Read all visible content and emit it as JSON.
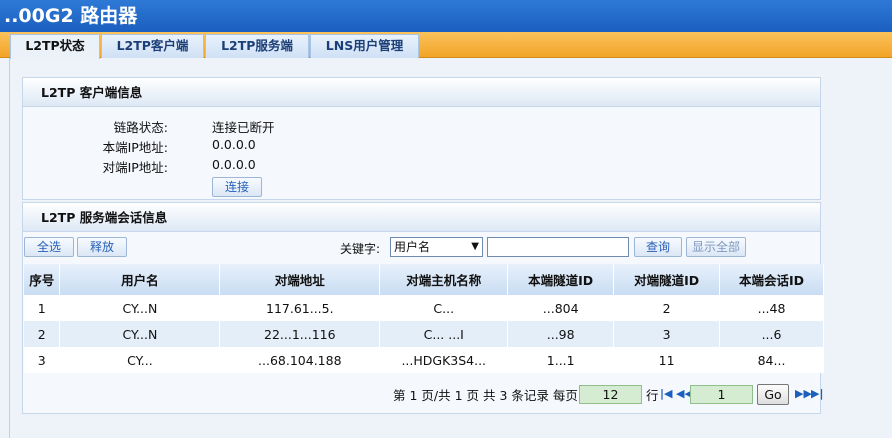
{
  "window": {
    "title": "..00G2 路由器"
  },
  "tabs": [
    {
      "label": "L2TP状态",
      "active": true
    },
    {
      "label": "L2TP客户端",
      "active": false
    },
    {
      "label": "L2TP服务端",
      "active": false
    },
    {
      "label": "LNS用户管理",
      "active": false
    }
  ],
  "client_panel": {
    "title": "L2TP 客户端信息",
    "fields": [
      {
        "label": "链路状态:",
        "value": "连接已断开"
      },
      {
        "label": "本端IP地址:",
        "value": "0.0.0.0"
      },
      {
        "label": "对端IP地址:",
        "value": "0.0.0.0"
      }
    ],
    "connect_label": "连接"
  },
  "server_panel": {
    "title": "L2TP 服务端会话信息",
    "select_all_label": "全选",
    "release_label": "释放",
    "keyword_label": "关键字:",
    "keyword_option": "用户名",
    "search_value": "",
    "query_label": "查询",
    "show_all_label": "显示全部"
  },
  "table": {
    "headers": [
      "序号",
      "用户名",
      "对端地址",
      "对端主机名称",
      "本端隧道ID",
      "对端隧道ID",
      "本端会话ID"
    ],
    "rows": [
      [
        "1",
        "CY...N",
        "117.61...5.",
        "C...",
        "...804",
        "2",
        "...48"
      ],
      [
        "2",
        "CY...N",
        "22...1...116",
        "C... ...I",
        "...98",
        "3",
        "...6"
      ],
      [
        "3",
        "CY...",
        "...68.104.188",
        "...HDGK3S4...",
        "1...1",
        "11",
        "84..."
      ]
    ]
  },
  "pager": {
    "summary": "第 1 页/共 1 页 共 3 条记录 每页",
    "per_page": "12",
    "row_unit": "行",
    "current_page": "1",
    "go_label": "Go",
    "icons": [
      "first-page-icon",
      "prev-page-icon",
      "next-page-icon",
      "last-page-icon"
    ]
  },
  "colors": {
    "topbar": "#1b5fbf",
    "tabbar": "#f2a427",
    "table_header": "#c9dcf2",
    "pager_box": "#d6ecd2"
  }
}
